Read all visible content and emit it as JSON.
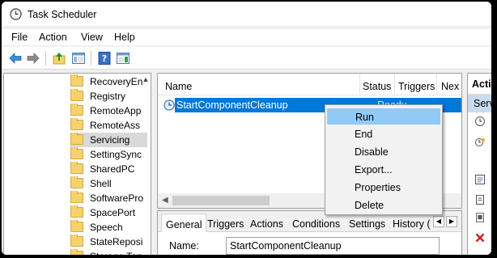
{
  "window": {
    "title": "Task Scheduler"
  },
  "menu": [
    "File",
    "Action",
    "View",
    "Help"
  ],
  "toolbar": {
    "icons": [
      "back-arrow-icon",
      "forward-arrow-icon",
      "up-folder-icon",
      "show-hide-tree-icon",
      "help-icon",
      "show-hide-action-pane-icon"
    ]
  },
  "tree": {
    "items": [
      {
        "label": "RecoveryEn",
        "selected": false
      },
      {
        "label": "Registry",
        "selected": false
      },
      {
        "label": "RemoteApp",
        "selected": false
      },
      {
        "label": "RemoteAss",
        "selected": false
      },
      {
        "label": "Servicing",
        "selected": true
      },
      {
        "label": "SettingSync",
        "selected": false
      },
      {
        "label": "SharedPC",
        "selected": false
      },
      {
        "label": "Shell",
        "selected": false
      },
      {
        "label": "SoftwarePro",
        "selected": false
      },
      {
        "label": "SpacePort",
        "selected": false
      },
      {
        "label": "Speech",
        "selected": false
      },
      {
        "label": "StateReposi",
        "selected": false
      },
      {
        "label": "Storage Ten",
        "selected": false
      }
    ]
  },
  "task_list": {
    "columns": [
      "Name",
      "Status",
      "Triggers",
      "Nex"
    ],
    "rows": [
      {
        "name": "StartComponentCleanup",
        "status": "Ready"
      }
    ]
  },
  "context_menu": {
    "items": [
      "Run",
      "End",
      "Disable",
      "Export...",
      "Properties",
      "Delete"
    ],
    "highlighted": "Run"
  },
  "details": {
    "tabs": [
      "General",
      "Triggers",
      "Actions",
      "Conditions",
      "Settings",
      "History ("
    ],
    "active_tab": "General",
    "name_label": "Name:",
    "name_value": "StartComponentCleanup"
  },
  "actions_pane": {
    "header": "Acti",
    "selected": "Servi"
  },
  "colors": {
    "selection": "#0078d7",
    "menu_highlight": "#91c9f7",
    "action_subheader": "#c9dbee"
  }
}
